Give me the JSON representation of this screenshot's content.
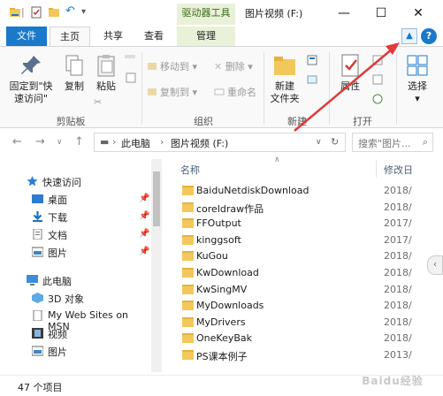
{
  "window": {
    "context_tab": "驱动器工具",
    "title": "图片视频 (F:)",
    "controls": {
      "minimize": "—",
      "maximize": "☐",
      "close": "✕"
    }
  },
  "tabs": {
    "file": "文件",
    "home": "主页",
    "share": "共享",
    "view": "查看",
    "manage": "管理"
  },
  "ribbon": {
    "pin": "固定到\"快\n速访问\"",
    "pin_l1": "固定到\"快",
    "pin_l2": "速访问\"",
    "copy": "复制",
    "paste": "粘贴",
    "move_to": "移动到",
    "copy_to": "复制到",
    "delete": "删除",
    "rename": "重命名",
    "new_folder_l1": "新建",
    "new_folder_l2": "文件夹",
    "properties": "属性",
    "select": "选择",
    "groups": {
      "clipboard": "剪贴板",
      "organize": "组织",
      "new": "新建",
      "open": "打开"
    }
  },
  "address": {
    "crumbs": [
      "此电脑",
      "图片视频 (F:)"
    ],
    "search_placeholder": "搜索\"图片..."
  },
  "sidebar": {
    "items": [
      {
        "label": "快速访问",
        "icon": "star-icon"
      },
      {
        "label": "桌面",
        "icon": "desktop-icon",
        "pinned": true
      },
      {
        "label": "下载",
        "icon": "download-icon",
        "pinned": true
      },
      {
        "label": "文档",
        "icon": "document-icon",
        "pinned": true
      },
      {
        "label": "图片",
        "icon": "pictures-icon",
        "pinned": true
      },
      {
        "label": "此电脑",
        "icon": "computer-icon"
      },
      {
        "label": "3D 对象",
        "icon": "3d-objects-icon"
      },
      {
        "label": "My Web Sites on MSN",
        "icon": "web-sites-icon"
      },
      {
        "label": "视频",
        "icon": "video-icon"
      },
      {
        "label": "图片",
        "icon": "pictures-icon"
      }
    ]
  },
  "columns": {
    "name": "名称",
    "modified": "修改日"
  },
  "files": [
    {
      "name": "BaiduNetdiskDownload",
      "date": "2018/"
    },
    {
      "name": "coreldraw作品",
      "date": "2018/"
    },
    {
      "name": "FFOutput",
      "date": "2017/"
    },
    {
      "name": "kinggsoft",
      "date": "2017/"
    },
    {
      "name": "KuGou",
      "date": "2018/"
    },
    {
      "name": "KwDownload",
      "date": "2018/"
    },
    {
      "name": "KwSingMV",
      "date": "2018/"
    },
    {
      "name": "MyDownloads",
      "date": "2018/"
    },
    {
      "name": "MyDrivers",
      "date": "2018/"
    },
    {
      "name": "OneKeyBak",
      "date": "2018/"
    },
    {
      "name": "PS课本例子",
      "date": "2013/"
    }
  ],
  "status": {
    "count": "47 个项目"
  },
  "colors": {
    "accent": "#1979ca",
    "folder": "#f3c85b",
    "annotation_arrow": "#e03a3a",
    "context_tab": "#e9f1d8"
  },
  "watermark": "Baidu经验"
}
